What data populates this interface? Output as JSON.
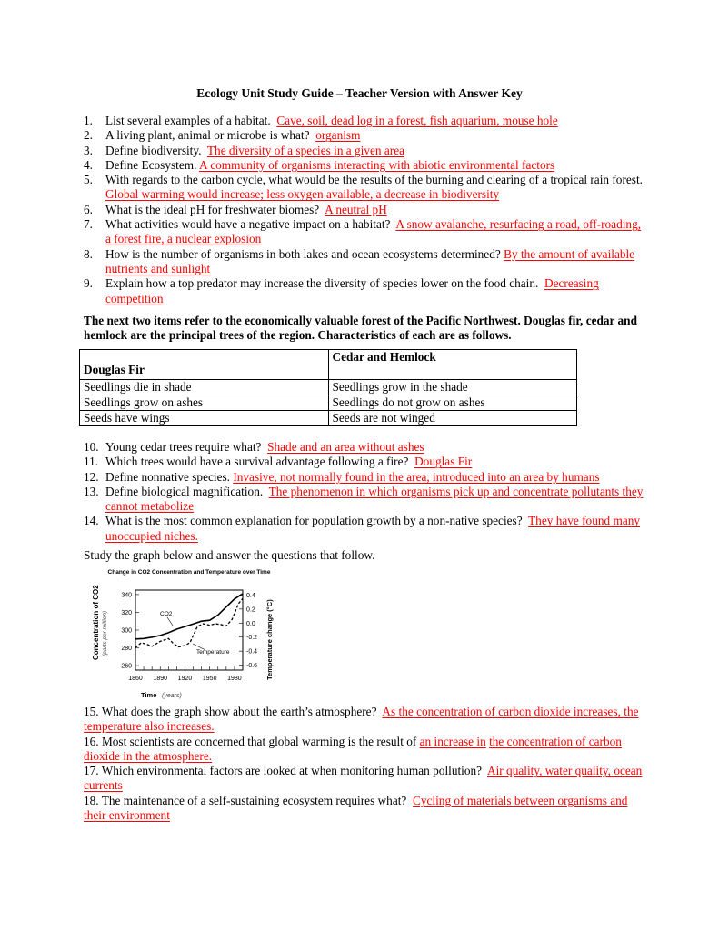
{
  "title": "Ecology Unit Study Guide – Teacher Version with Answer Key",
  "questions_part1": [
    {
      "num": "1.",
      "q": "List several examples of a habitat.",
      "a": "Cave, soil, dead log in a forest, fish aquarium, mouse hole"
    },
    {
      "num": "2.",
      "q": "A living plant, animal or microbe is what?",
      "a": "organism"
    },
    {
      "num": "3.",
      "q": "Define biodiversity.",
      "a": "The diversity of a species in a given area"
    },
    {
      "num": "4.",
      "q": "Define Ecosystem.",
      "a": "A community of organisms interacting with abiotic environmental factors"
    },
    {
      "num": "5.",
      "q": "With regards to the carbon cycle, what would be the results of the burning and clearing of a tropical rain forest.",
      "a": "Global warming would increase; less oxygen available, a decrease in biodiversity"
    },
    {
      "num": "6.",
      "q": "What is the ideal pH for freshwater biomes?",
      "a": "A neutral pH"
    },
    {
      "num": "7.",
      "q": "What activities would have a negative impact on a habitat?",
      "a": "A snow avalanche, resurfacing a road, off-roading, a forest fire, a nuclear explosion"
    },
    {
      "num": "8.",
      "q": "How is the number of organisms in both lakes and ocean ecosystems determined?",
      "a": "By the amount of available nutrients and sunlight"
    },
    {
      "num": "9.",
      "q": "Explain how a top predator may increase the diversity of species lower on the food chain.",
      "a": "Decreasing competition"
    }
  ],
  "intro": "The next two items refer to the economically valuable forest of the Pacific Northwest. Douglas fir, cedar and hemlock are the principal trees of the region. Characteristics of each are as follows.",
  "table": {
    "headers": [
      "Douglas Fir",
      "Cedar and Hemlock"
    ],
    "rows": [
      [
        "Seedlings die in shade",
        "Seedlings grow in the shade"
      ],
      [
        "Seedlings grow on ashes",
        "Seedlings do not grow on ashes"
      ],
      [
        "Seeds have wings",
        "Seeds are not winged"
      ]
    ]
  },
  "questions_part2": [
    {
      "num": "10.",
      "q": "Young cedar trees require what?",
      "a": "Shade and an area without ashes"
    },
    {
      "num": "11.",
      "q": "Which trees would have a survival advantage following a fire?",
      "a": "Douglas Fir"
    },
    {
      "num": "12.",
      "q": "Define nonnative species.",
      "a": "Invasive, not normally found in the area, introduced into an area by humans"
    },
    {
      "num": "13.",
      "q": "Define biological magnification.",
      "a": "The phenomenon in which organisms pick up and concentrate pollutants they cannot metabolize"
    },
    {
      "num": "14.",
      "q": "What is the most common explanation for population growth by a non-native species?",
      "a": "They have found many unoccupied niches."
    }
  ],
  "study_prompt": "Study the graph below and answer the questions that follow.",
  "chart_data": {
    "type": "line",
    "title": "Change in CO2 Concentration and Temperature over Time",
    "xlabel": "Time",
    "xlabel_unit": "(years)",
    "ylabel_left": "Concentration of CO2",
    "ylabel_left_unit": "(parts per million)",
    "ylabel_right": "Temperature change (°C)",
    "x_ticks": [
      "1860",
      "1890",
      "1920",
      "1950",
      "1980"
    ],
    "xlim": [
      1860,
      1990
    ],
    "y_left_ticks": [
      "340",
      "320",
      "300",
      "280",
      "260"
    ],
    "ylim_left": [
      255,
      345
    ],
    "y_right_ticks": [
      "0.4",
      "0.2",
      "0.0",
      "-0.2",
      "-0.4",
      "-0.6"
    ],
    "ylim_right": [
      -0.67,
      0.47
    ],
    "series": [
      {
        "name": "CO2",
        "axis": "left",
        "style": "solid",
        "x": [
          1860,
          1870,
          1880,
          1890,
          1900,
          1910,
          1920,
          1930,
          1940,
          1950,
          1960,
          1970,
          1980,
          1990
        ],
        "values": [
          290,
          290.5,
          292,
          294,
          297,
          301,
          304,
          307,
          310,
          311,
          317,
          326,
          335,
          341
        ]
      },
      {
        "name": "Temperature",
        "axis": "right",
        "style": "dashed",
        "x": [
          1860,
          1867,
          1873,
          1880,
          1890,
          1900,
          1905,
          1912,
          1920,
          1926,
          1935,
          1942,
          1950,
          1957,
          1963,
          1970,
          1977,
          1985,
          1990
        ],
        "values": [
          -0.35,
          -0.28,
          -0.3,
          -0.33,
          -0.26,
          -0.22,
          -0.28,
          -0.34,
          -0.32,
          -0.28,
          -0.05,
          -0.01,
          -0.03,
          -0.01,
          -0.02,
          -0.04,
          0.05,
          0.28,
          0.35
        ]
      }
    ],
    "annotations": [
      "CO2",
      "Temperature"
    ]
  },
  "questions_part3": [
    {
      "q": "15. What does the graph show about the earth’s atmosphere?",
      "a": "As the concentration of carbon dioxide increases, the temperature also increases."
    },
    {
      "q": "16. Most scientists are concerned that global warming is the result of",
      "a": "an increase in",
      "a2": "the concentration of carbon dioxide in the atmosphere."
    },
    {
      "q": "17. Which environmental factors are looked at when monitoring human pollution?",
      "a": "Air quality, water quality, ocean currents"
    },
    {
      "q": "18. The maintenance of a self-sustaining ecosystem requires what?",
      "a": "Cycling of materials between organisms and their environment"
    }
  ],
  "colors": {
    "answer": "#ff0000",
    "text": "#000000"
  }
}
